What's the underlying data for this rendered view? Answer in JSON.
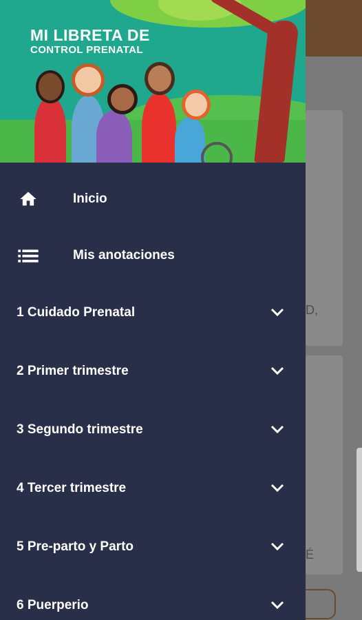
{
  "header": {
    "title_line1": "MI LIBRETA DE",
    "title_line2": "CONTROL PRENATAL"
  },
  "menu": {
    "items": [
      {
        "label": "Inicio",
        "icon": "home-icon"
      },
      {
        "label": "Mis anotaciones",
        "icon": "list-icon"
      }
    ],
    "sections": [
      {
        "label": "1 Cuidado Prenatal"
      },
      {
        "label": "2 Primer trimestre"
      },
      {
        "label": "3 Segundo trimestre"
      },
      {
        "label": "4 Tercer trimestre"
      },
      {
        "label": "5 Pre-parto y Parto"
      },
      {
        "label": "6 Puerperio"
      }
    ]
  },
  "background": {
    "fragment1": "D,",
    "fragment2": "É"
  },
  "colors": {
    "drawer_bg": "#292e49",
    "header_bg": "#20a88f",
    "text": "#ffffff",
    "app_bar": "#6b4a2e"
  }
}
